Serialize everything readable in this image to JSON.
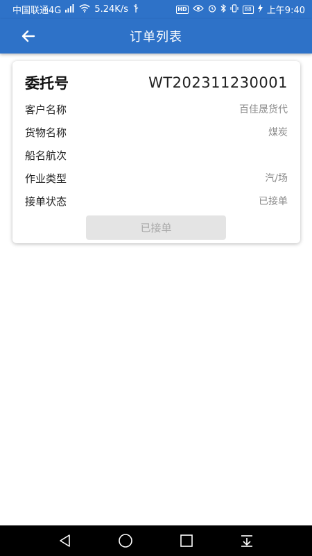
{
  "status_bar": {
    "carrier": "中国联通4G",
    "net_speed": "5.24K/s",
    "battery": "88",
    "time": "上午9:40",
    "hd_badge": "HD"
  },
  "app_bar": {
    "title": "订单列表",
    "back_icon": "arrow-left-icon"
  },
  "order": {
    "id_label": "委托号",
    "id_value": "WT202311230001",
    "fields": [
      {
        "label": "客户名称",
        "value": "百佳晟货代"
      },
      {
        "label": "货物名称",
        "value": "煤炭"
      },
      {
        "label": "船名航次",
        "value": ""
      },
      {
        "label": "作业类型",
        "value": "汽/场"
      },
      {
        "label": "接单状态",
        "value": "已接单"
      }
    ],
    "status_button": "已接单"
  },
  "colors": {
    "primary": "#2e72c8",
    "button_disabled_bg": "#e4e4e4",
    "button_disabled_text": "#a8a8a8",
    "value_text": "#8a8a8a"
  },
  "nav_bar": {
    "icons": [
      "back-triangle-icon",
      "home-circle-icon",
      "recents-square-icon",
      "notification-pull-icon"
    ]
  }
}
